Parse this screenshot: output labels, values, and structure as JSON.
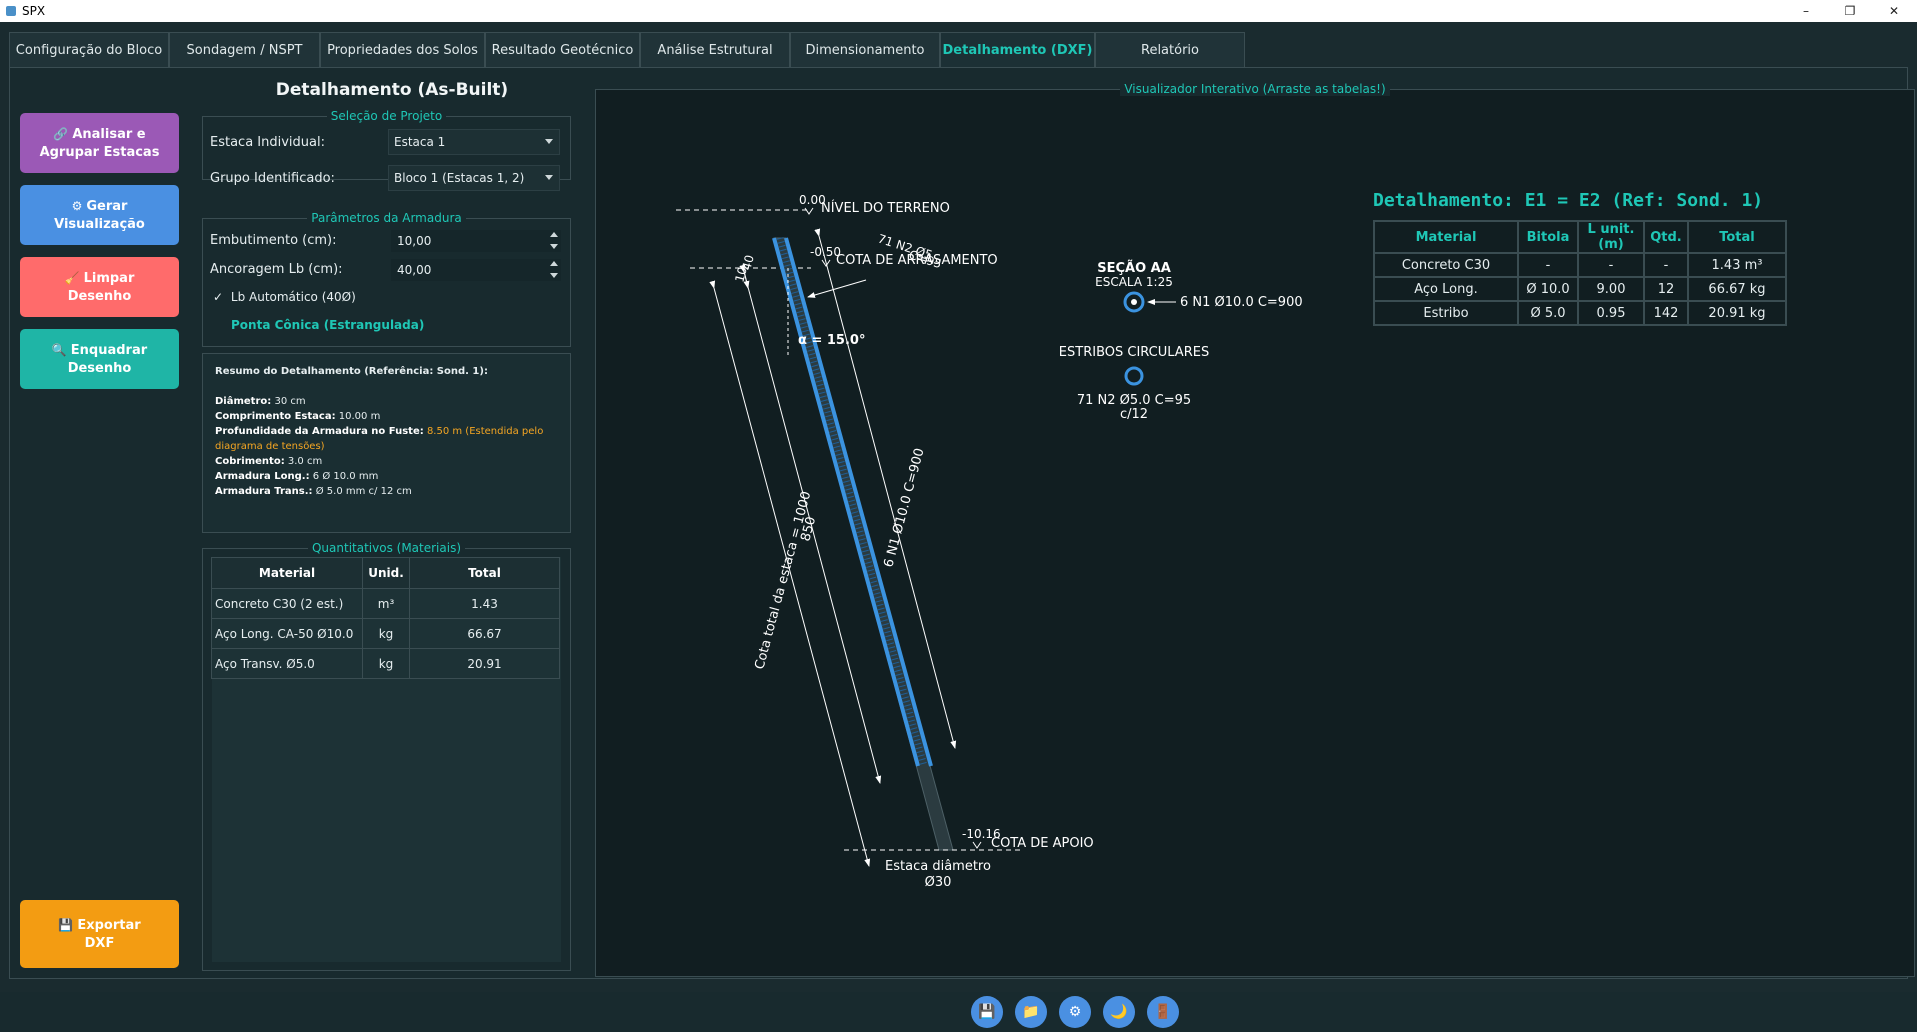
{
  "window": {
    "title": "SPX",
    "minimize": "–",
    "maximize": "❐",
    "close": "✕"
  },
  "tabs": [
    {
      "label": "Configuração do Bloco"
    },
    {
      "label": "Sondagem / NSPT"
    },
    {
      "label": "Propriedades dos Solos"
    },
    {
      "label": "Resultado Geotécnico"
    },
    {
      "label": "Análise Estrutural"
    },
    {
      "label": "Dimensionamento"
    },
    {
      "label": "Detalhamento (DXF)",
      "active": true
    },
    {
      "label": "Relatório"
    }
  ],
  "sidebar": {
    "analisar": {
      "icon": "🔗",
      "line1": "Analisar e",
      "line2": "Agrupar Estacas",
      "color": "#9b59b6"
    },
    "gerar": {
      "icon": "⚙",
      "line1": "Gerar",
      "line2": "Visualização",
      "color": "#4a90e2"
    },
    "limpar": {
      "icon": "🧹",
      "line1": "Limpar",
      "line2": "Desenho",
      "color": "#ff6b6b"
    },
    "enquadrar": {
      "icon": "🔍",
      "line1": "Enquadrar",
      "line2": "Desenho",
      "color": "#1fb5a6"
    },
    "exportar": {
      "icon": "💾",
      "line1": "Exportar",
      "line2": "DXF",
      "color": "#f39c12"
    }
  },
  "panel": {
    "title": "Detalhamento (As-Built)",
    "selecao": {
      "legend": "Seleção de Projeto",
      "estaca_label": "Estaca Individual:",
      "estaca_value": "Estaca 1",
      "grupo_label": "Grupo Identificado:",
      "grupo_value": "Bloco 1 (Estacas 1, 2)"
    },
    "armadura": {
      "legend": "Parâmetros da Armadura",
      "embutimento_label": "Embutimento (cm):",
      "embutimento_value": "10,00",
      "ancoragem_label": "Ancoragem Lb (cm):",
      "ancoragem_value": "40,00",
      "lb_auto_check": "✓",
      "lb_auto_label": "Lb Automático (40Ø)",
      "ponta_conica_label": "Ponta Cônica (Estrangulada)"
    },
    "resumo": {
      "title": "Resumo do Detalhamento (Referência: Sond. 1):",
      "diametro_k": "Diâmetro:",
      "diametro_v": "30 cm",
      "comprimento_k": "Comprimento Estaca:",
      "comprimento_v": "10.00 m",
      "profundidade_k": "Profundidade da Armadura no Fuste:",
      "profundidade_v": "8.50 m (Estendida pelo diagrama de tensões)",
      "cobrimento_k": "Cobrimento:",
      "cobrimento_v": "3.0 cm",
      "long_k": "Armadura Long.:",
      "long_v": "6 Ø 10.0 mm",
      "trans_k": "Armadura Trans.:",
      "trans_v": "Ø 5.0 mm c/ 12 cm"
    },
    "quantitativos": {
      "legend": "Quantitativos (Materiais)",
      "headers": [
        "Material",
        "Unid.",
        "Total"
      ],
      "rows": [
        [
          "Concreto C30 (2 est.)",
          "m³",
          "1.43"
        ],
        [
          "Aço Long. CA-50 Ø10.0",
          "kg",
          "66.67"
        ],
        [
          "Aço Transv. Ø5.0",
          "kg",
          "20.91"
        ]
      ]
    }
  },
  "viewer": {
    "legend": "Visualizador Interativo (Arraste as tabelas!)",
    "drawing": {
      "nivel_valor": "0.00",
      "nivel_label": "NÍVEL DO TERRENO",
      "arrasamento_valor": "-0.50",
      "arrasamento_label": "COTA DE ARRASAMENTO",
      "estribo_callout": "71 N2 Ø5",
      "estribo_callout_c": "C=95",
      "embut_dim": "10",
      "ancor_dim": "40",
      "alpha": "α = 15.0°",
      "total_dim": "Cota total da estaca = 1000",
      "armadura_dim": "850",
      "long_callout": "6 N1 Ø10.0 C=900",
      "apoio_valor": "-10.16",
      "apoio_label": "COTA DE APOIO",
      "estaca_label": "Estaca diâmetro",
      "estaca_diam": "Ø30",
      "secao_title": "SEÇÃO AA",
      "secao_escala": "ESCALA 1:25",
      "secao_callout": "6 N1 Ø10.0 C=900",
      "estribos_title": "ESTRIBOS CIRCULARES",
      "estribos_callout": "71 N2 Ø5.0 C=95",
      "estribos_spacing": "c/12"
    },
    "detail_title": "Detalhamento: E1 = E2 (Ref: Sond. 1)",
    "detail_headers": [
      "Material",
      "Bitola",
      "L unit.(m)",
      "Qtd.",
      "Total"
    ],
    "detail_rows": [
      [
        "Concreto C30",
        "-",
        "-",
        "-",
        "1.43 m³"
      ],
      [
        "Aço Long.",
        "Ø 10.0",
        "9.00",
        "12",
        "66.67 kg"
      ],
      [
        "Estribo",
        "Ø 5.0",
        "0.95",
        "142",
        "20.91 kg"
      ]
    ]
  },
  "bottom_icons": [
    "save-icon",
    "folder-icon",
    "settings-icon",
    "moon-icon",
    "exit-icon"
  ]
}
